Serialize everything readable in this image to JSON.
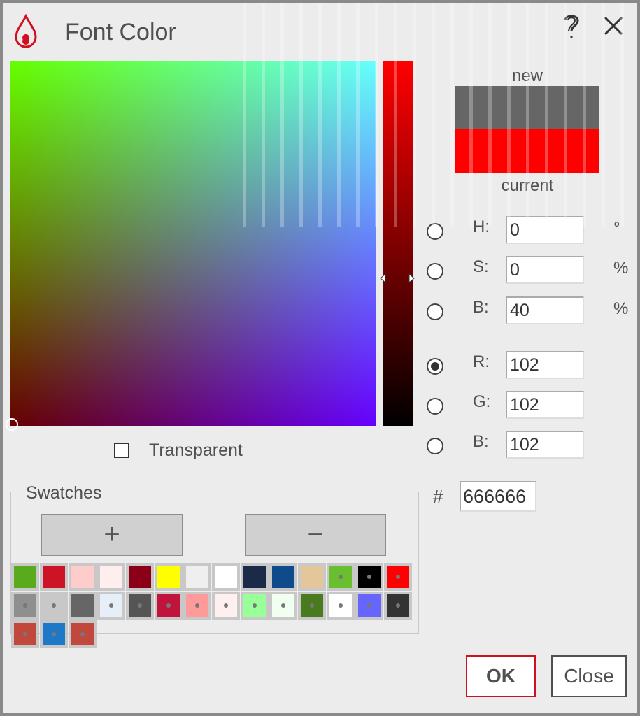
{
  "window": {
    "title": "Font Color",
    "icon": "color-drop-icon",
    "help_icon": "help-icon",
    "close_icon": "close-icon"
  },
  "colors": {
    "accent": "#d01020",
    "new": "#666666",
    "current": "#ff0000"
  },
  "preview": {
    "new_label": "new",
    "current_label": "current"
  },
  "fields": [
    {
      "key": "H",
      "label": "H:",
      "value": "0",
      "unit": "°",
      "selected": false
    },
    {
      "key": "S",
      "label": "S:",
      "value": "0",
      "unit": "%",
      "selected": false
    },
    {
      "key": "Bv",
      "label": "B:",
      "value": "40",
      "unit": "%",
      "selected": false
    },
    {
      "key": "R",
      "label": "R:",
      "value": "102",
      "unit": "",
      "selected": true
    },
    {
      "key": "G",
      "label": "G:",
      "value": "102",
      "unit": "",
      "selected": false
    },
    {
      "key": "Bc",
      "label": "B:",
      "value": "102",
      "unit": "",
      "selected": false
    }
  ],
  "hex": {
    "prefix": "#",
    "value": "666666"
  },
  "transparent": {
    "label": "Transparent",
    "checked": false
  },
  "swatches": {
    "legend": "Swatches",
    "add_label": "+",
    "remove_label": "−",
    "items": [
      {
        "color": "#5aaa1e",
        "dot": false
      },
      {
        "color": "#cc1426",
        "dot": false
      },
      {
        "color": "#ffcccc",
        "dot": false
      },
      {
        "color": "#ffeeee",
        "dot": false
      },
      {
        "color": "#8b0016",
        "dot": false
      },
      {
        "color": "#ffff00",
        "dot": false
      },
      {
        "color": "#efefef",
        "dot": false
      },
      {
        "color": "#ffffff",
        "dot": false
      },
      {
        "color": "#1c2a4a",
        "dot": false
      },
      {
        "color": "#0f4a8a",
        "dot": false
      },
      {
        "color": "#e3c79a",
        "dot": false
      },
      {
        "color": "#6abf30",
        "dot": true
      },
      {
        "color": "#000000",
        "dot": true
      },
      {
        "color": "#ff0000",
        "dot": true
      },
      {
        "color": "#8f8f8f",
        "dot": true
      },
      {
        "color": "#c8c8c8",
        "dot": true
      },
      {
        "color": "#666666",
        "dot": false
      },
      {
        "color": "#e6eef8",
        "dot": true
      },
      {
        "color": "#555555",
        "dot": true
      },
      {
        "color": "#c0143c",
        "dot": true
      },
      {
        "color": "#ff9a9a",
        "dot": true
      },
      {
        "color": "#fff0f0",
        "dot": true
      },
      {
        "color": "#99ff99",
        "dot": true
      },
      {
        "color": "#f0fff0",
        "dot": true
      },
      {
        "color": "#4a7a1e",
        "dot": true
      },
      {
        "color": "#ffffff",
        "dot": true
      },
      {
        "color": "#6666ff",
        "dot": true
      },
      {
        "color": "#333333",
        "dot": true
      },
      {
        "color": "#c0483c",
        "dot": true
      },
      {
        "color": "#1e78c8",
        "dot": true
      },
      {
        "color": "#c0483c",
        "dot": true
      }
    ]
  },
  "buttons": {
    "ok": "OK",
    "close": "Close"
  }
}
